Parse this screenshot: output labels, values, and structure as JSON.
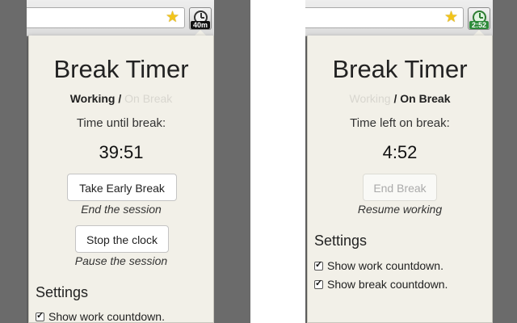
{
  "panels": [
    {
      "badge": "40m",
      "badge_color": "#111111",
      "title": "Break Timer",
      "mode_working": "Working",
      "mode_separator": "/",
      "mode_break": "On Break",
      "active_mode": "working",
      "label": "Time until break:",
      "time": "39:51",
      "buttons": [
        {
          "label": "Take Early Break",
          "hint": "End the session",
          "disabled": false
        },
        {
          "label": "Stop the clock",
          "hint": "Pause the session",
          "disabled": false
        }
      ],
      "settings_heading": "Settings",
      "settings": [
        {
          "label": "Show work countdown.",
          "checked": true
        }
      ]
    },
    {
      "badge": "2:52",
      "badge_color": "#2e8b3a",
      "title": "Break Timer",
      "mode_working": "Working",
      "mode_separator": "/",
      "mode_break": "On Break",
      "active_mode": "break",
      "label": "Time left on break:",
      "time": "4:52",
      "buttons": [
        {
          "label": "End Break",
          "hint": "Resume working",
          "disabled": true
        }
      ],
      "settings_heading": "Settings",
      "settings": [
        {
          "label": "Show work countdown.",
          "checked": true
        },
        {
          "label": "Show break countdown.",
          "checked": true
        }
      ]
    }
  ],
  "icons": {
    "star": "bookmark-star-icon",
    "extension": "break-timer-clock-icon"
  }
}
